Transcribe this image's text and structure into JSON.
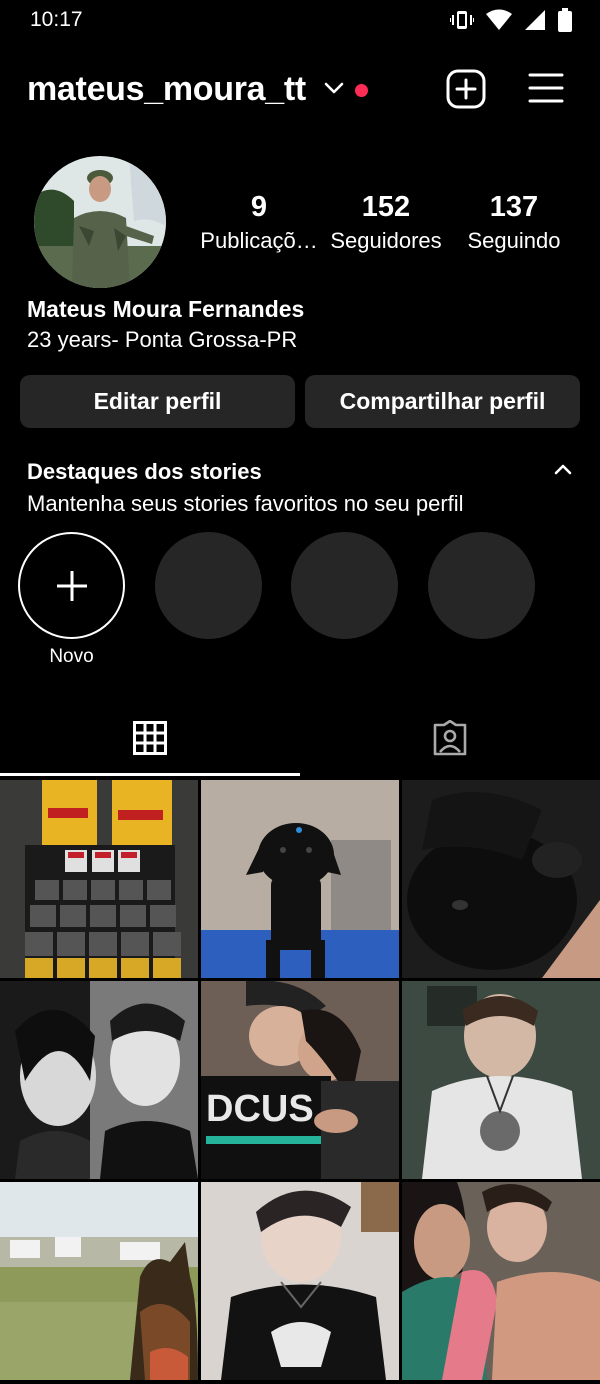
{
  "status": {
    "time": "10:17"
  },
  "header": {
    "username": "mateus_moura_tt"
  },
  "profile": {
    "stats": [
      {
        "value": "9",
        "label": "Publicaçõ…"
      },
      {
        "value": "152",
        "label": "Seguidores"
      },
      {
        "value": "137",
        "label": "Seguindo"
      }
    ],
    "full_name": "Mateus Moura Fernandes",
    "bio": "23 years- Ponta Grossa-PR"
  },
  "buttons": {
    "edit": "Editar perfil",
    "share": "Compartilhar perfil"
  },
  "highlights": {
    "title": "Destaques dos stories",
    "subtitle": "Mantenha seus stories favoritos no seu perfil",
    "new_label": "Novo"
  },
  "colors": {
    "background": "#000000",
    "button": "#262626",
    "notification": "#ff2d55"
  },
  "icons": [
    "vibrate-icon",
    "wifi-icon",
    "signal-icon",
    "battery-icon",
    "chevron-down-icon",
    "new-post-icon",
    "menu-icon",
    "chevron-up-icon",
    "plus-icon",
    "grid-icon",
    "tagged-icon"
  ]
}
